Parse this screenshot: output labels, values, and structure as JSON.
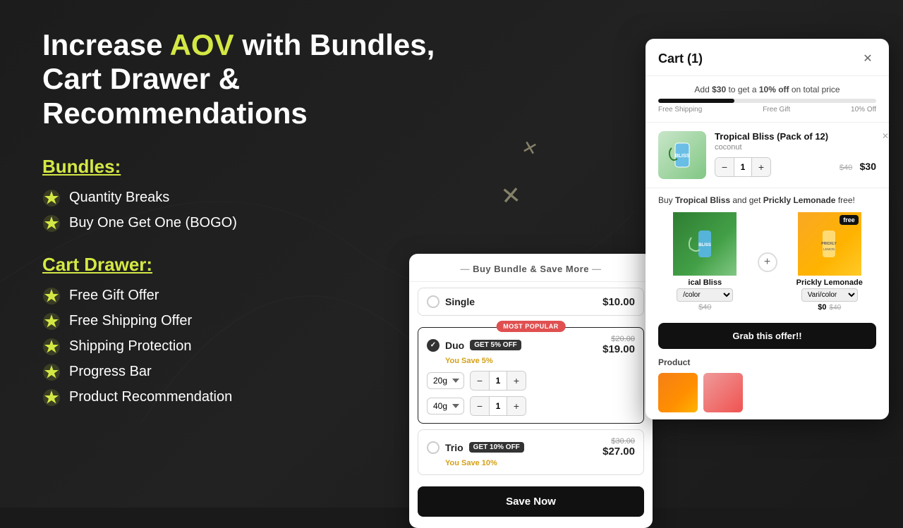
{
  "page": {
    "background_color": "#1c1c1c"
  },
  "heading": {
    "prefix": "Increase ",
    "highlight": "AOV",
    "suffix": " with Bundles,\nCart Drawer & Recommendations"
  },
  "bundles_section": {
    "title": "Bundles:",
    "features": [
      "Quantity Breaks",
      "Buy One Get One (BOGO)"
    ]
  },
  "cart_drawer_section": {
    "title": "Cart Drawer:",
    "features": [
      "Free Gift Offer",
      "Free Shipping Offer",
      "Shipping Protection",
      "Progress Bar",
      "Product Recommendation"
    ]
  },
  "bundle_panel": {
    "header": "Buy Bundle & Save More",
    "options": [
      {
        "id": "single",
        "name": "Single",
        "selected": false,
        "price": "$10.00",
        "old_price": null,
        "discount_badge": null,
        "save_text": null
      },
      {
        "id": "duo",
        "name": "Duo",
        "selected": true,
        "discount_badge": "GET 5% OFF",
        "old_price": "$20.00",
        "price": "$19.00",
        "save_text": "You Save 5%",
        "most_popular": true,
        "variants": [
          {
            "value": "20g",
            "label": "20g"
          },
          {
            "value": "40g",
            "label": "40g"
          }
        ]
      },
      {
        "id": "trio",
        "name": "Trio",
        "selected": false,
        "discount_badge": "GET 10% OFF",
        "old_price": "$30.00",
        "price": "$27.00",
        "save_text": "You Save 10%"
      }
    ],
    "save_button_label": "Save Now"
  },
  "cart_drawer": {
    "title": "Cart (1)",
    "progress": {
      "text_prefix": "Add ",
      "amount": "$30",
      "text_mid": " to get a ",
      "discount": "10% off",
      "text_suffix": " on total price",
      "fill_percent": 35,
      "labels": [
        "Free Shipping",
        "Free Gift",
        "10% Off"
      ]
    },
    "item": {
      "name": "Tropical Bliss (Pack of 12)",
      "variant": "coconut",
      "qty": 1,
      "old_price": "$40",
      "new_price": "$30"
    },
    "bogo": {
      "text_prefix": "Buy ",
      "product1": "Tropical Bliss",
      "text_mid": " and get ",
      "product2": "Prickly Lemonade",
      "text_suffix": " free!",
      "product1_name": "ical Bliss",
      "product1_variant": "/color",
      "product1_old_price": "$40",
      "product2_name": "Prickly Lemonade",
      "product2_variant": "Vari/color",
      "product2_price": "$0",
      "product2_old_price": "$40",
      "free_label": "free"
    },
    "grab_button": "Grab this offer!!",
    "related_label": "Product"
  }
}
